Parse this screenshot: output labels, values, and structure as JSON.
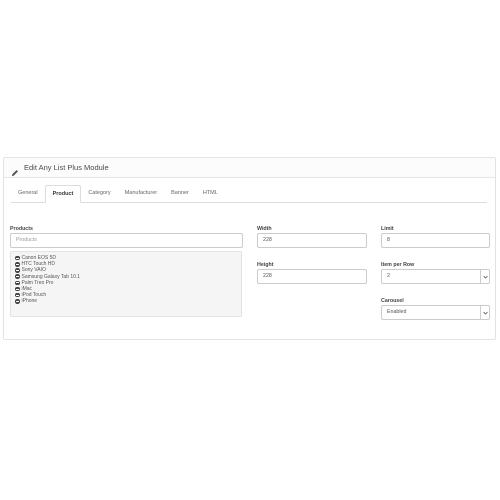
{
  "panel": {
    "title": "Edit Any List Plus Module"
  },
  "tabs": [
    {
      "label": "General",
      "active": false
    },
    {
      "label": "Product",
      "active": true
    },
    {
      "label": "Category",
      "active": false
    },
    {
      "label": "Manufacturer",
      "active": false
    },
    {
      "label": "Banner",
      "active": false
    },
    {
      "label": "HTML",
      "active": false
    }
  ],
  "form": {
    "products_label": "Products",
    "products_placeholder": "Products",
    "products": [
      "Canon EOS 5D",
      "HTC Touch HD",
      "Sony VAIO",
      "Samsung Galaxy Tab 10.1",
      "Palm Treo Pro",
      "iMac",
      "iPod Touch",
      "iPhone"
    ],
    "width_label": "Width",
    "width_value": "228",
    "height_label": "Height",
    "height_value": "228",
    "limit_label": "Limit",
    "limit_value": "8",
    "per_row_label": "Item per Row",
    "per_row_value": "2",
    "carousel_label": "Carousel",
    "carousel_value": "Enabled"
  },
  "icons": {
    "heading": "pencil-icon",
    "product_remove": "minus-circle-icon",
    "select": "chevron-down-icon"
  }
}
